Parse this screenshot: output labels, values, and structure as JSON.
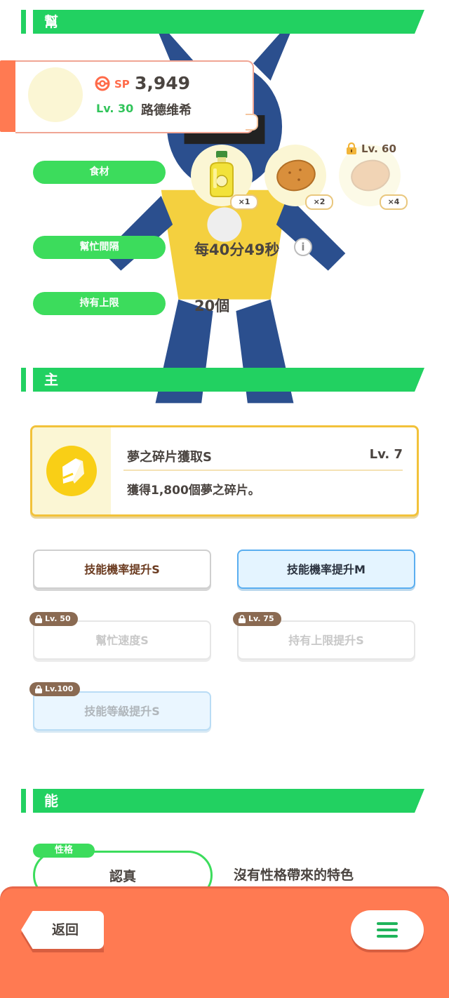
{
  "sections": {
    "help": "幫忙能力",
    "skills": "主技能／副技能",
    "details": "能力詳情"
  },
  "pokemon": {
    "sp_label": "SP",
    "sp_value": "3,949",
    "level": "Lv. 30",
    "name": "路德维希"
  },
  "help_rows": {
    "ingredients_label": "食材",
    "interval_label": "幫忙間隔",
    "interval_value": "每40分49秒",
    "capacity_label": "持有上限",
    "capacity_value": "20個"
  },
  "ingredients": [
    {
      "icon": "oil-bottle-icon",
      "qty": "×1"
    },
    {
      "icon": "potato-icon",
      "qty": "×2"
    },
    {
      "icon": "potato-icon",
      "qty": "×4",
      "lock": "Lv. 60"
    }
  ],
  "main_skill": {
    "name": "夢之碎片獲取S",
    "level": "Lv. 7",
    "description": "獲得1,800個夢之碎片。"
  },
  "sub_skills": [
    {
      "label": "技能機率提升S"
    },
    {
      "label": "技能機率提升M"
    },
    {
      "label": "幫忙速度S",
      "lock": "Lv. 50"
    },
    {
      "label": "持有上限提升S",
      "lock": "Lv. 75"
    },
    {
      "label": "技能等級提升S",
      "lock": "Lv.100"
    }
  ],
  "nature": {
    "tag": "性格",
    "value": "認真",
    "description": "沒有性格帶來的特色"
  },
  "footer": {
    "back_label": "返回"
  },
  "colors": {
    "accent_green": "#22d161",
    "footer_orange": "#ff7a52",
    "skill_gold": "#f2c23a"
  }
}
